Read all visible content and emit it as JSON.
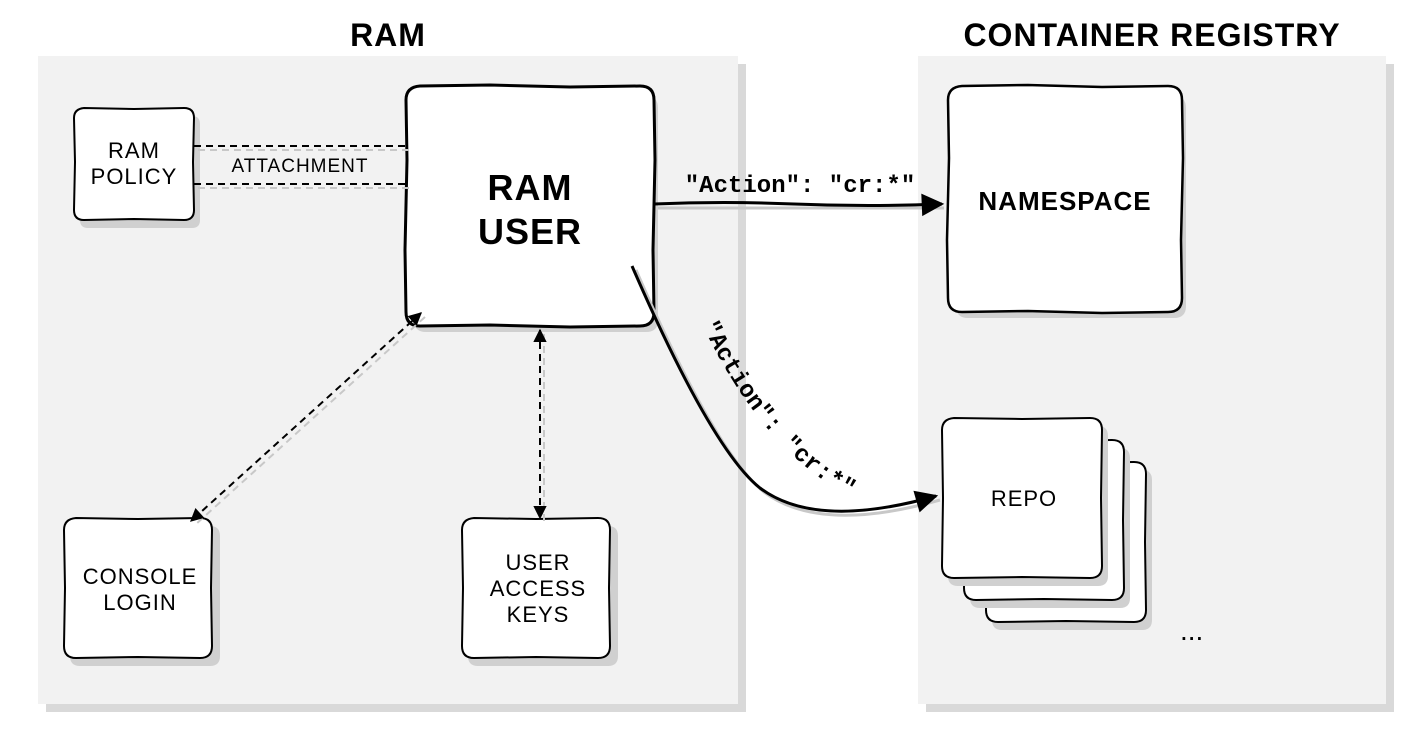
{
  "panels": {
    "ram": {
      "title": "RAM"
    },
    "registry": {
      "title": "CONTAINER REGISTRY"
    }
  },
  "nodes": {
    "ram_policy": {
      "line1": "RAM",
      "line2": "POLICY"
    },
    "ram_user": {
      "line1": "RAM",
      "line2": "USER"
    },
    "console_login": {
      "line1": "CONSOLE",
      "line2": "LOGIN"
    },
    "user_access_keys": {
      "line1": "USER",
      "line2": "ACCESS",
      "line3": "KEYS"
    },
    "namespace": {
      "label": "NAMESPACE"
    },
    "repo": {
      "label": "REPO"
    },
    "repo_ellipsis": "..."
  },
  "edges": {
    "attachment": {
      "label": "ATTACHMENT"
    },
    "to_namespace": {
      "label": "\"Action\": \"cr:*\""
    },
    "to_repo": {
      "label": "\"Action\": \"cr:*\""
    }
  }
}
